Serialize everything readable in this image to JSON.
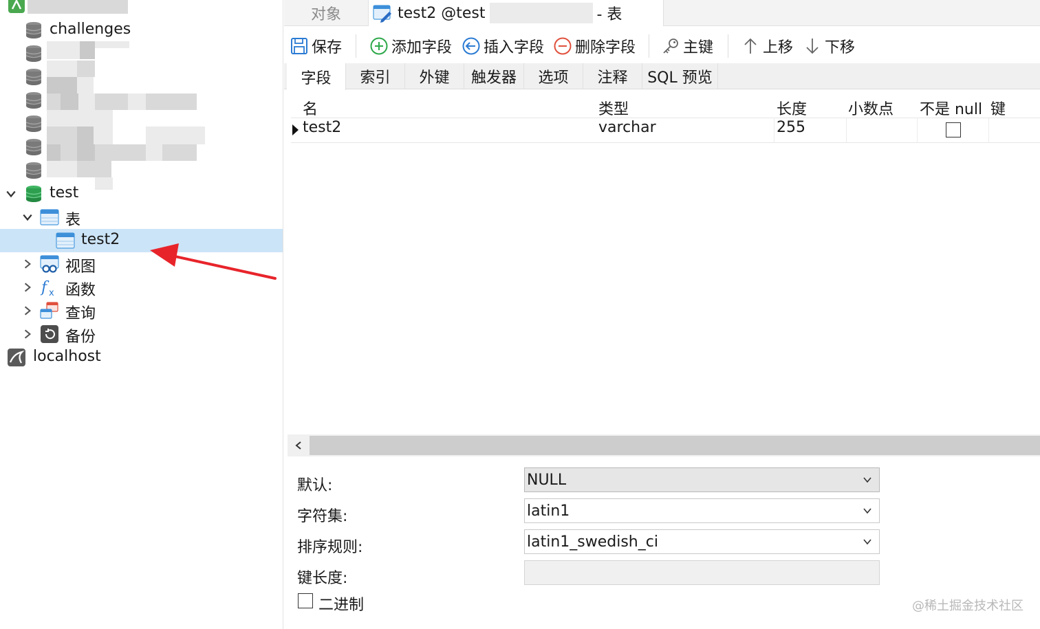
{
  "document_tabs": {
    "objects_label": "对象",
    "active_title": "test2 @test",
    "active_suffix": "- 表"
  },
  "toolbar": {
    "save_label": "保存",
    "add_field_label": "添加字段",
    "insert_field_label": "插入字段",
    "delete_field_label": "删除字段",
    "primary_key_label": "主键",
    "move_up_label": "上移",
    "move_down_label": "下移"
  },
  "sub_tabs": [
    "字段",
    "索引",
    "外键",
    "触发器",
    "选项",
    "注释",
    "SQL 预览"
  ],
  "fields_grid": {
    "columns": [
      "名",
      "类型",
      "长度",
      "小数点",
      "不是 null",
      "键"
    ],
    "rows": [
      {
        "name": "test2",
        "type": "varchar",
        "length": "255",
        "decimals": "",
        "not_null": false,
        "key": ""
      }
    ]
  },
  "tree": {
    "db_challenges": "challenges",
    "db_test": "test",
    "group_tables": "表",
    "table_test2": "test2",
    "group_views": "视图",
    "group_functions": "函数",
    "group_queries": "查询",
    "group_backups": "备份",
    "connection_localhost": "localhost"
  },
  "properties": {
    "default_label": "默认:",
    "default_value": "NULL",
    "charset_label": "字符集:",
    "charset_value": "latin1",
    "collation_label": "排序规则:",
    "collation_value": "latin1_swedish_ci",
    "key_length_label": "键长度:",
    "key_length_value": "",
    "binary_label": "二进制",
    "binary_checked": false
  },
  "watermark": "@稀土掘金技术社区",
  "colors": {
    "selection": "#cce4f7",
    "annotation_arrow": "#e8242b",
    "db_active": "#2e9e4f"
  }
}
